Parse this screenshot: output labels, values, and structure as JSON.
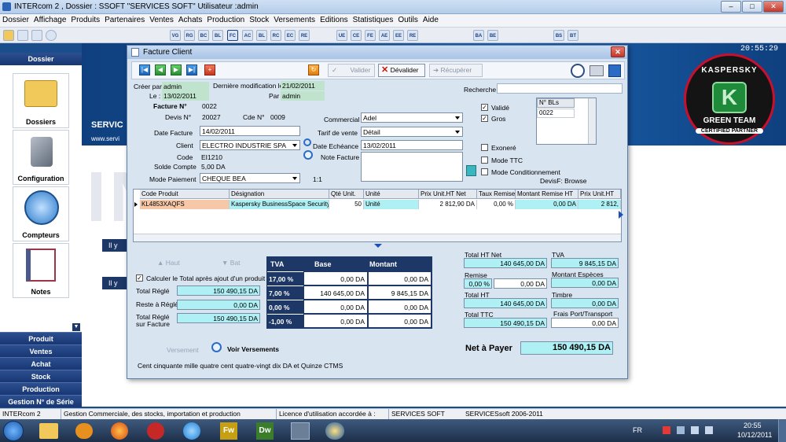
{
  "app": {
    "title": "INTERcom  2 , Dossier : SSOFT  \"SERVICES SOFT\"  Utilisateur :admin",
    "clock": "20:55:29"
  },
  "menu": [
    "Dossier",
    "Affichage",
    "Produits",
    "Partenaires",
    "Ventes",
    "Achats",
    "Production",
    "Stock",
    "Versements",
    "Editions",
    "Statistiques",
    "Outils",
    "Aide"
  ],
  "toolbar": [
    "VG",
    "RG",
    "BC",
    "BL",
    "FC",
    "AC",
    "BL",
    "RC",
    "EC",
    "RE",
    "UE",
    "CE",
    "FE",
    "AE",
    "EE",
    "RE",
    "BA",
    "BE",
    "BS",
    "BT"
  ],
  "sidebar": {
    "header": "Dossier",
    "tiles": [
      "Dossiers",
      "Configuration",
      "Compteurs",
      "Notes"
    ],
    "nav": [
      "Produit",
      "Ventes",
      "Achat",
      "Stock",
      "Production",
      "Gestion N° de Série"
    ]
  },
  "background": {
    "brand": "SERVIC",
    "url": "www.servi",
    "big": "INTI",
    "iy1": "Il y",
    "iy2": "Il y"
  },
  "kaspersky": {
    "top": "KASPERSKY",
    "mid": "GREEN TEAM",
    "bot": "CERTIFIED PARTNER"
  },
  "dialog": {
    "title": "Facture Client",
    "buttons": {
      "valider": "Valider",
      "devalider": "Dévalider",
      "recuperer": "Récupérer"
    },
    "meta": {
      "cree_par_label": "Créer par :",
      "cree_par": "admin",
      "derniere_label": "Dernière modification le :",
      "derniere": "21/02/2011",
      "le_label": "Le :",
      "le": "13/02/2011",
      "par_label": "Par :",
      "par": "admin",
      "recherche_label": "Recherche"
    },
    "facture": {
      "facture_label": "Facture N°",
      "facture": "0022",
      "devis_label": "Devis N°",
      "devis": "20027",
      "cde_label": "Cde N°",
      "cde": "0009",
      "date_label": "Date Facture",
      "date": "14/02/2011",
      "client_label": "Client",
      "client": "ELECTRO INDUSTRIE SPA",
      "code_label": "Code",
      "code": "EI1210",
      "solde_label": "Solde Compte",
      "solde": "5,00 DA",
      "mode_label": "Mode Paiement",
      "mode": "CHEQUE BEA",
      "ratio": "1:1",
      "commercial_label": "Commercial",
      "commercial": "Adel",
      "tarif_label": "Tarif de vente",
      "tarif": "Détail",
      "echeance_label": "Date Echéance",
      "echeance": "13/02/2011",
      "note_label": "Note Facture"
    },
    "checks": {
      "valide": "Validé",
      "gros": "Gros",
      "exonere": "Exoneré",
      "modettc": "Mode TTC",
      "modecond": "Mode Conditionnement",
      "devisf": "DevisF: Browse",
      "nbls_label": "N° BLs",
      "nbls": "0022"
    },
    "grid": {
      "headers": [
        "Code Produit",
        "Désignation",
        "Qté Unit.",
        "Unité",
        "Prix Unit.HT Net",
        "Taux Remise",
        "Montant Remise HT",
        "Prix Unit.HT"
      ],
      "row": [
        "KL4853XAQFS",
        "Kaspersky BusinessSpace Security I",
        "50",
        "Unité",
        "2 812,90 DA",
        "0,00 %",
        "0,00 DA",
        "2 812,"
      ]
    },
    "bottom": {
      "haut": "Haut",
      "bat": "Bat",
      "calc": "Calculer le Total après ajout d'un produit",
      "total_regle_label": "Total Réglé",
      "total_regle": "150 490,15 DA",
      "reste_label": "Reste à Réglé",
      "reste": "0,00 DA",
      "trsf_label1": "Total Réglé",
      "trsf_label2": "sur Facture",
      "trsf": "150 490,15 DA",
      "versement": "Versement",
      "voir": "Voir Versements",
      "lettres": "Cent cinquante mille quatre cent quatre-vingt dix DA et Quinze CTMS"
    },
    "tva": {
      "headers": [
        "TVA",
        "Base",
        "Montant"
      ],
      "rows": [
        [
          "17,00 %",
          "0,00 DA",
          "0,00 DA"
        ],
        [
          "7,00 %",
          "140 645,00 DA",
          "9 845,15 DA"
        ],
        [
          "0,00 %",
          "0,00 DA",
          "0,00 DA"
        ],
        [
          "-1,00 %",
          "0,00 DA",
          "0,00 DA"
        ]
      ]
    },
    "totaux": {
      "tht_label": "Total HT Net",
      "tht": "140 645,00 DA",
      "tva_label": "TVA",
      "tva": "9 845,15 DA",
      "remise_label": "Remise",
      "remise_pct": "0,00 %",
      "remise": "0,00 DA",
      "esp_label": "Montant Espèces",
      "esp": "0,00 DA",
      "ht_label": "Total HT",
      "ht": "140 645,00 DA",
      "timbre_label": "Timbre",
      "timbre": "0,00 DA",
      "ttc_label": "Total TTC",
      "ttc": "150 490,15 DA",
      "frais_label": "Frais Port/Transport",
      "frais": "0,00 DA",
      "net_label": "Net à Payer",
      "net": "150 490,15 DA"
    }
  },
  "status": {
    "s1": "INTERcom 2",
    "s2": "Gestion Commerciale, des stocks, importation et production",
    "s3": "Licence d'utilisation accordée à :",
    "s4": "SERVICES SOFT",
    "s5": "SERVICESsoft 2006-2011"
  },
  "taskbar": {
    "lang": "FR",
    "time": "20:55",
    "date": "10/12/2011",
    "apps": [
      "Fw",
      "Dw"
    ]
  }
}
